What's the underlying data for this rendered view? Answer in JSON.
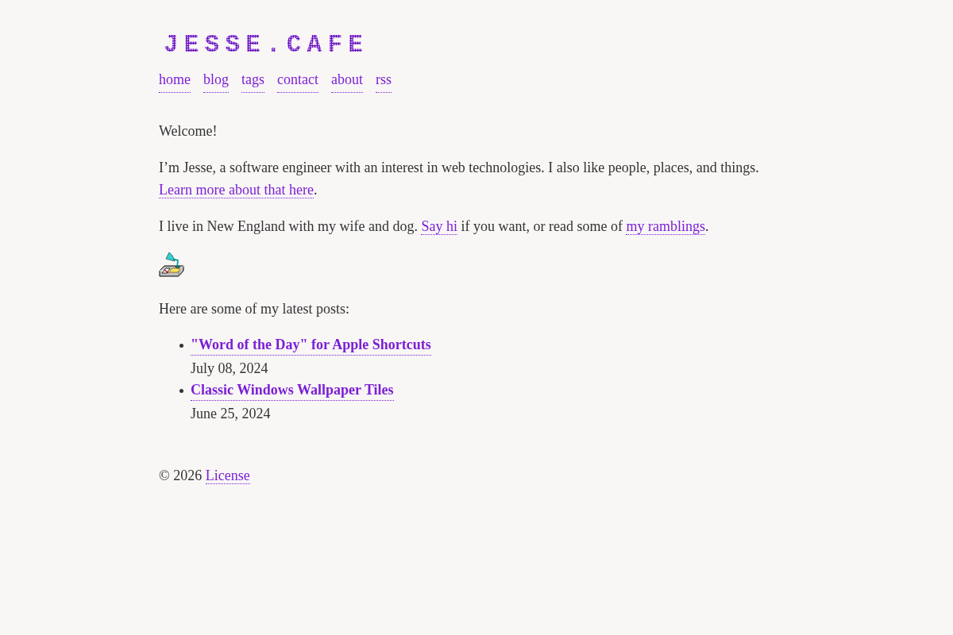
{
  "header": {
    "logo": "JESSE.CAFE",
    "nav": [
      {
        "label": "home"
      },
      {
        "label": "blog"
      },
      {
        "label": "tags"
      },
      {
        "label": "contact"
      },
      {
        "label": "about"
      },
      {
        "label": "rss"
      }
    ]
  },
  "intro": [
    {
      "parts": [
        {
          "kind": "text",
          "text": "Welcome!"
        }
      ]
    },
    {
      "parts": [
        {
          "kind": "text",
          "text": "I’m Jesse, a software engineer with an interest in web technologies. I also like people, places, and things. "
        },
        {
          "kind": "link",
          "text": "Learn more about that here"
        },
        {
          "kind": "text",
          "text": "."
        }
      ]
    },
    {
      "parts": [
        {
          "kind": "text",
          "text": "I live in New England with my wife and dog. "
        },
        {
          "kind": "link",
          "text": "Say hi"
        },
        {
          "kind": "text",
          "text": " if you want, or read some of "
        },
        {
          "kind": "link",
          "text": "my ramblings"
        },
        {
          "kind": "text",
          "text": "."
        }
      ]
    }
  ],
  "latest_posts": {
    "heading": "Here are some of my latest posts:",
    "posts": [
      {
        "title": "\"Word of the Day\" for Apple Shortcuts",
        "date": "July 08, 2024"
      },
      {
        "title": "Classic Windows Wallpaper Tiles",
        "date": "June 25, 2024"
      }
    ]
  },
  "footer": {
    "parts": [
      {
        "kind": "text",
        "text": "© 2026 "
      },
      {
        "kind": "link",
        "text": "License"
      }
    ]
  }
}
